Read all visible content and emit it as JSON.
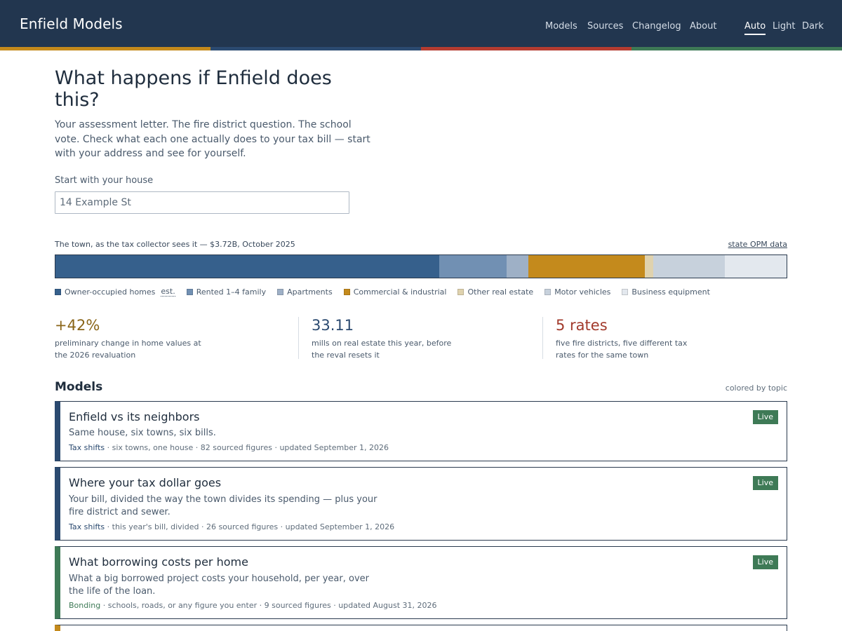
{
  "header": {
    "brand": "Enfield Models",
    "nav": [
      "Models",
      "Sources",
      "Changelog",
      "About"
    ],
    "theme": [
      "Auto",
      "Light",
      "Dark"
    ],
    "theme_selected": "Auto"
  },
  "colors": {
    "header_bg": "#22364f",
    "stripe": [
      "#c48a1c",
      "#2b4a70",
      "#b53c30",
      "#3e7a56"
    ],
    "badge_live": "#3e7a56"
  },
  "hero": {
    "title": "What happens if Enfield does this?",
    "subtitle": "Your assessment letter. The fire district question. The school vote. Check what each one actually does to your tax bill — start with your address and see for yourself.",
    "input_label": "Start with your house",
    "input_placeholder": "14 Example St"
  },
  "town": {
    "caption": "The town, as the tax collector sees it — $3.72B, October 2025",
    "source_link": "state OPM data",
    "est_label": "est."
  },
  "chart_data": {
    "type": "bar",
    "title": "The town, as the tax collector sees it — $3.72B, October 2025",
    "categories": [
      "Owner-occupied homes",
      "Rented 1–4 family",
      "Apartments",
      "Commercial & industrial",
      "Other real estate",
      "Motor vehicles",
      "Business equipment"
    ],
    "values": [
      52.5,
      9.2,
      3.0,
      15.9,
      1.2,
      9.8,
      8.4
    ],
    "colors": [
      "#36608c",
      "#7190b3",
      "#9eb0c6",
      "#c48a1c",
      "#dfd2ae",
      "#c7d1dc",
      "#e3e8ee"
    ],
    "legend": "bottom-left",
    "unit": "percent of total assessed value"
  },
  "stats": [
    {
      "value": "+42%",
      "desc": "preliminary change in home values at the 2026 revaluation",
      "color": "#8a6518"
    },
    {
      "value": "33.11",
      "desc": "mills on real estate this year, before the reval resets it",
      "color": "#2b4a70"
    },
    {
      "value": "5 rates",
      "desc": "five fire districts, five different tax rates for the same town",
      "color": "#a23a2c"
    }
  ],
  "models": {
    "title": "Models",
    "note": "colored by topic",
    "cards": [
      {
        "title": "Enfield vs its neighbors",
        "desc": "Same house, six towns, six bills.",
        "topic": "Tax shifts",
        "meta": " · six towns, one house · 82 sourced figures · updated September 1, 2026",
        "badge": "Live",
        "accent": "#2b4a70"
      },
      {
        "title": "Where your tax dollar goes",
        "desc": "Your bill, divided the way the town divides its spending — plus your fire district and sewer.",
        "topic": "Tax shifts",
        "meta": " · this year's bill, divided · 26 sourced figures · updated September 1, 2026",
        "badge": "Live",
        "accent": "#2b4a70"
      },
      {
        "title": "What borrowing costs per home",
        "desc": "What a big borrowed project costs your household, per year, over the life of the loan.",
        "topic": "Bonding",
        "meta": " · schools, roads, or any figure you enter · 9 sourced figures · updated August 31, 2026",
        "badge": "Live",
        "accent": "#3e7a56"
      }
    ],
    "next_accent": "#c48a1c"
  }
}
